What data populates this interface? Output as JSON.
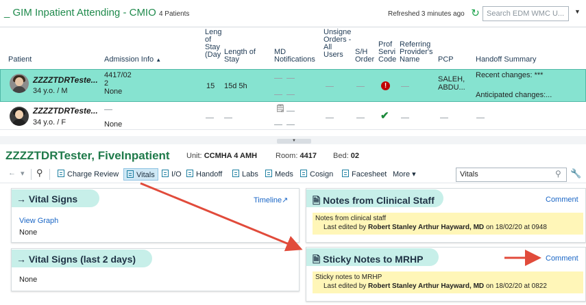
{
  "list": {
    "title": "_ GIM Inpatient Attending - CMIO",
    "patient_count": "4 Patients",
    "refreshed": "Refreshed 3 minutes ago",
    "search_placeholder": "Search EDM WMC U...",
    "columns": {
      "patient": "Patient",
      "admission_info": "Admission Info",
      "length_of_stay_days": [
        "Leng",
        "of",
        "Stay",
        "(Day"
      ],
      "length_of_stay": [
        "Length of",
        "Stay"
      ],
      "md_notifications": [
        "MD",
        "Notifications"
      ],
      "unsigned_orders": [
        "Unsigne",
        "Orders -",
        "All",
        "Users"
      ],
      "sh_order": [
        "S/H",
        "Order"
      ],
      "prof_service_code": [
        "Prof",
        "Servi",
        "Code"
      ],
      "referring_provider": [
        "Referring",
        "Provider's",
        "Name"
      ],
      "pcp": "PCP",
      "handoff_summary": "Handoff Summary"
    },
    "rows": [
      {
        "name": "ZZZZTDRTeste...",
        "demo": "34 y.o. / M",
        "admission_line1": "4417/02",
        "admission_line2": "2",
        "admission_line3": "None",
        "los_days": "15",
        "los": "15d 5h",
        "pcp_line1": "SALEH,",
        "pcp_line2": "ABDU...",
        "handoff_line1": "Recent changes: ***",
        "handoff_line2": "Anticipated changes:..."
      },
      {
        "name": "ZZZZTDRTeste...",
        "demo": "34 y.o. / F",
        "admission_line3": "None"
      }
    ]
  },
  "patient": {
    "name": "ZZZZTDRTester, FiveInpatient",
    "unit_label": "Unit:",
    "unit": "CCMHA 4 AMH",
    "room_label": "Room:",
    "room": "4417",
    "bed_label": "Bed:",
    "bed": "02"
  },
  "toolbar": {
    "charge_review": "Charge Review",
    "vitals": "Vitals",
    "io": "I/O",
    "handoff": "Handoff",
    "labs": "Labs",
    "meds": "Meds",
    "cosign": "Cosign",
    "facesheet": "Facesheet",
    "more": "More",
    "search_value": "Vitals"
  },
  "cards": {
    "vital_signs": {
      "title": "Vital Signs",
      "timeline": "Timeline",
      "view_graph": "View Graph",
      "value": "None"
    },
    "vital_signs_2days": {
      "title": "Vital Signs (last 2 days)",
      "value": "None"
    },
    "notes_clinical": {
      "title": "Notes from Clinical Staff",
      "comment": "Comment",
      "note_text": "Notes from clinical staff",
      "edited_prefix": "Last edited by",
      "edited_by": "Robert Stanley Arthur Hayward, MD",
      "edited_on": "on 18/02/20 at 0948"
    },
    "sticky_notes": {
      "title": "Sticky Notes to MRHP",
      "comment": "Comment",
      "note_text": "Sticky notes to MRHP",
      "edited_prefix": "Last edited by",
      "edited_by": "Robert Stanley Arthur Hayward, MD",
      "edited_on": "on 18/02/20 at 0822"
    }
  },
  "colors": {
    "accent_green": "#1f8a4c",
    "selected_row": "#86e3d0",
    "card_title_bg": "#c7efe9",
    "note_yellow": "#fff6b8",
    "arrow_red": "#e14b3b"
  }
}
